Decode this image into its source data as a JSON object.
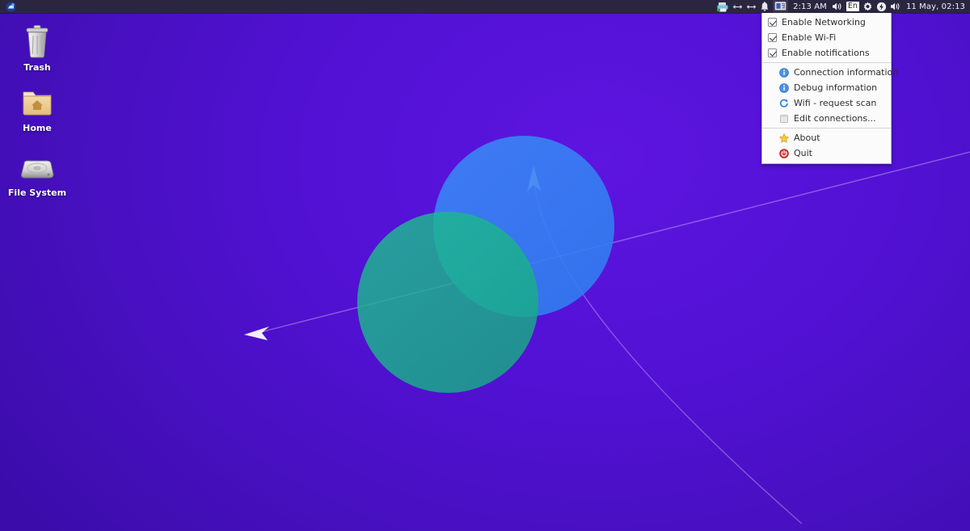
{
  "desktop": {
    "icons": [
      {
        "name": "Trash",
        "icon": "trash-icon"
      },
      {
        "name": "Home",
        "icon": "home-folder-icon"
      },
      {
        "name": "File System",
        "icon": "harddisk-icon"
      }
    ]
  },
  "panel": {
    "app_menu_icon": "applications-menu-icon",
    "tray": [
      {
        "icon": "printer-icon",
        "label": ""
      },
      {
        "icon": "arrows-horizontal-icon",
        "label": ""
      },
      {
        "icon": "arrows-horizontal-icon",
        "label": ""
      },
      {
        "icon": "bell-icon",
        "label": ""
      },
      {
        "icon": "network-manager-icon",
        "label": ""
      }
    ],
    "clock_small": "2:13 AM",
    "volume_icon": "speaker-icon",
    "keyboard_layout": "En",
    "settings_icon": "gear-icon",
    "power_icon": "power-bolt-icon",
    "volume_icon_2": "speaker-icon",
    "clock": "11 May, 02:13"
  },
  "nm_menu": {
    "items": [
      {
        "type": "checkbox",
        "label": "Enable Networking",
        "checked": true,
        "icon": "checkbox-checked-icon"
      },
      {
        "type": "checkbox",
        "label": "Enable Wi-Fi",
        "checked": true,
        "icon": "checkbox-checked-icon"
      },
      {
        "type": "checkbox",
        "label": "Enable notifications",
        "checked": true,
        "icon": "checkbox-checked-icon"
      },
      {
        "type": "separator"
      },
      {
        "type": "item",
        "label": "Connection information",
        "icon": "info-icon"
      },
      {
        "type": "item",
        "label": "Debug information",
        "icon": "info-icon"
      },
      {
        "type": "item",
        "label": "Wifi - request scan",
        "icon": "refresh-icon"
      },
      {
        "type": "item",
        "label": "Edit connections...",
        "icon": "window-icon"
      },
      {
        "type": "separator"
      },
      {
        "type": "item",
        "label": "About",
        "icon": "star-icon"
      },
      {
        "type": "item",
        "label": "Quit",
        "icon": "power-icon"
      }
    ]
  },
  "wallpaper": {
    "bg_color_light": "#5d15e0",
    "bg_color_dark": "#3c0cab",
    "circle_blue": "#2f7ff0",
    "circle_green": "#14b488",
    "line_color": "#ffffff"
  }
}
